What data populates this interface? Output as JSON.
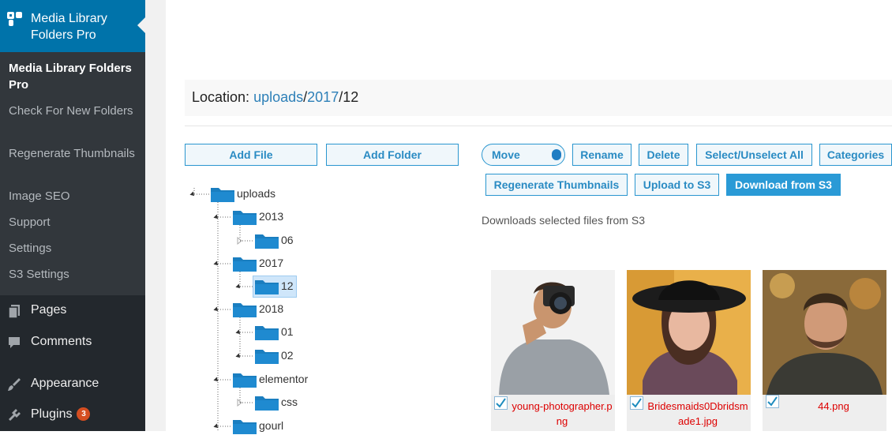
{
  "sidebar": {
    "plugin_title": "Media Library Folders Pro",
    "submenu": [
      {
        "label": "Media Library Folders Pro",
        "current": true
      },
      {
        "label": "Check For New Folders"
      },
      {
        "label": "Regenerate Thumbnails"
      },
      {
        "label": "Image SEO"
      },
      {
        "label": "Support"
      },
      {
        "label": "Settings"
      },
      {
        "label": "S3 Settings"
      }
    ],
    "menu": [
      {
        "label": "Pages",
        "icon": "pages-icon"
      },
      {
        "label": "Comments",
        "icon": "comments-icon"
      },
      {
        "label": "Appearance",
        "icon": "appearance-icon"
      },
      {
        "label": "Plugins",
        "icon": "plugins-icon",
        "badge": "3"
      }
    ]
  },
  "location": {
    "label": "Location:",
    "crumbs": [
      "uploads",
      "2017"
    ],
    "current": "12"
  },
  "buttons": {
    "add_file": "Add File",
    "add_folder": "Add Folder",
    "move": "Move",
    "rename": "Rename",
    "delete": "Delete",
    "select_all": "Select/Unselect All",
    "categories": "Categories",
    "regenerate": "Regenerate Thumbnails",
    "upload_s3": "Upload to S3",
    "download_s3": "Download from S3"
  },
  "help_text": "Downloads selected files from S3",
  "tree": [
    {
      "label": "uploads"
    },
    {
      "label": "2013"
    },
    {
      "label": "06"
    },
    {
      "label": "2017"
    },
    {
      "label": "12",
      "selected": true
    },
    {
      "label": "2018"
    },
    {
      "label": "01"
    },
    {
      "label": "02"
    },
    {
      "label": "elementor"
    },
    {
      "label": "css"
    },
    {
      "label": "gourl"
    }
  ],
  "files": [
    {
      "name": "young-photographer.png",
      "checked": true
    },
    {
      "name": "Bridesmaids0Dbridsmade1.jpg",
      "checked": true
    },
    {
      "name": "44.png",
      "checked": true
    }
  ],
  "colors": {
    "wp_blue": "#0073aa",
    "sidebar_bg": "#23282d",
    "folder_blue": "#1a7ec0",
    "link_blue": "#2e80b8",
    "file_name_red": "#dd0000"
  }
}
